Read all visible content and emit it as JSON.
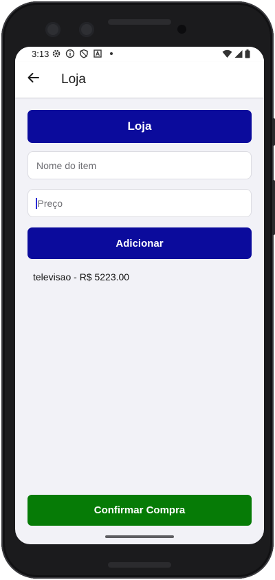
{
  "status_bar": {
    "time": "3:13",
    "left_icons": [
      "gear-icon",
      "info-icon",
      "shield-icon",
      "a-badge-icon",
      "dot-icon"
    ],
    "right_icons": [
      "wifi-icon",
      "signal-icon",
      "battery-icon"
    ]
  },
  "app_bar": {
    "back_icon": "arrow-left-icon",
    "title": "Loja"
  },
  "form": {
    "header_button_label": "Loja",
    "name_placeholder": "Nome do item",
    "price_placeholder": "Preço",
    "add_button_label": "Adicionar"
  },
  "items": [
    {
      "text": "televisao - R$ 5223.00"
    }
  ],
  "footer": {
    "confirm_button_label": "Confirmar Compra"
  },
  "colors": {
    "primary": "#0b0b9c",
    "confirm": "#067b06",
    "background": "#f2f2f7"
  }
}
